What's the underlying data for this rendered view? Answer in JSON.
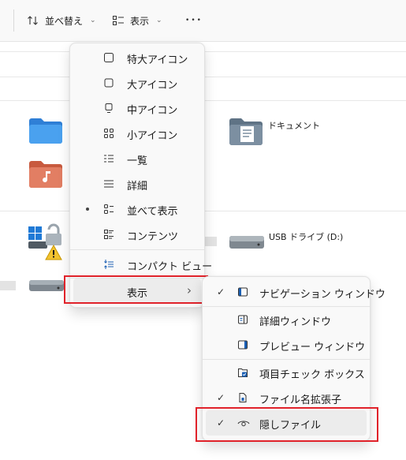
{
  "toolbar": {
    "sort_label": "並べ替え",
    "view_label": "表示",
    "more_label": "•••"
  },
  "files": {
    "documents_label": "ドキュメント",
    "usb_label": "USB ドライブ (D:)"
  },
  "view_menu": {
    "items": [
      {
        "label": "特大アイコン",
        "icon": "square-icon"
      },
      {
        "label": "大アイコン",
        "icon": "square-icon"
      },
      {
        "label": "中アイコン",
        "icon": "monitor-icon"
      },
      {
        "label": "小アイコン",
        "icon": "small-grid-icon"
      },
      {
        "label": "一覧",
        "icon": "list-icon"
      },
      {
        "label": "詳細",
        "icon": "details-icon"
      },
      {
        "label": "並べて表示",
        "icon": "tiles-icon",
        "selected": true
      },
      {
        "label": "コンテンツ",
        "icon": "content-icon"
      }
    ],
    "compact_label": "コンパクト ビュー",
    "show_label": "表示",
    "show_chevron": "›"
  },
  "show_submenu": {
    "items": [
      {
        "label": "ナビゲーション ウィンドウ",
        "icon": "navigation-pane-icon",
        "checked": true
      },
      {
        "label": "詳細ウィンドウ",
        "icon": "details-pane-icon",
        "checked": false
      },
      {
        "label": "プレビュー ウィンドウ",
        "icon": "preview-pane-icon",
        "checked": false
      },
      {
        "label": "項目チェック ボックス",
        "icon": "item-checkbox-icon",
        "checked": false
      },
      {
        "label": "ファイル名拡張子",
        "icon": "file-extension-icon",
        "checked": true
      },
      {
        "label": "隠しファイル",
        "icon": "eye-icon",
        "checked": true
      }
    ],
    "check_glyph": "✓"
  },
  "colors": {
    "highlight_border": "#e0222a",
    "menu_bg": "#f9f9f9",
    "hover_bg": "#ececec",
    "accent": "#0067c0"
  }
}
